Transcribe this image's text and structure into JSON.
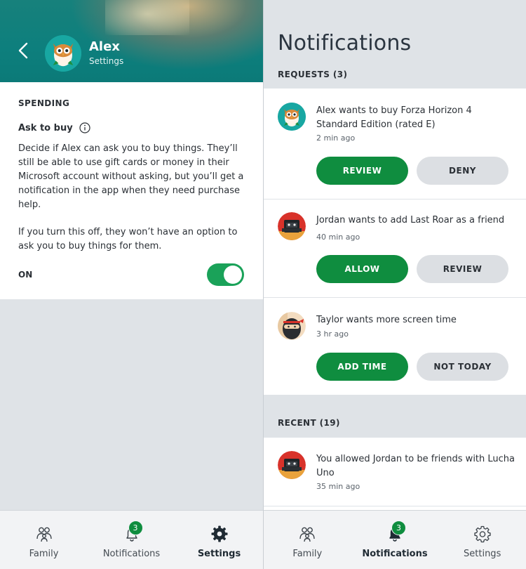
{
  "left": {
    "header": {
      "name": "Alex",
      "subtitle": "Settings"
    },
    "spending": {
      "section_label": "SPENDING",
      "ask_label": "Ask to buy",
      "description_1": "Decide if Alex can ask you to buy things. They’ll still be able to use gift cards or money in their Microsoft account without asking, but you’ll get a notification in the app when they need purchase help.",
      "description_2": "If you turn this off, they won’t have an option to ask you to buy things for them.",
      "toggle_label": "ON",
      "toggle_on": true
    },
    "nav": {
      "family": "Family",
      "notifications": "Notifications",
      "settings": "Settings",
      "badge": "3",
      "active": "settings"
    }
  },
  "right": {
    "title": "Notifications",
    "requests_label": "REQUESTS (3)",
    "requests": [
      {
        "text": "Alex wants to buy Forza Horizon 4 Standard Edition (rated E)",
        "time": "2 min ago",
        "primary": "REVIEW",
        "secondary": "DENY"
      },
      {
        "text": "Jordan wants to add Last Roar as a friend",
        "time": "40 min ago",
        "primary": "ALLOW",
        "secondary": "REVIEW"
      },
      {
        "text": "Taylor wants more screen time",
        "time": "3 hr ago",
        "primary": "ADD TIME",
        "secondary": "NOT TODAY"
      }
    ],
    "recent_label": "RECENT (19)",
    "recent": [
      {
        "text": "You allowed Jordan to be friends with Lucha Uno",
        "time": "35 min ago"
      }
    ],
    "nav": {
      "family": "Family",
      "notifications": "Notifications",
      "settings": "Settings",
      "badge": "3",
      "active": "notifications"
    }
  },
  "colors": {
    "accent_green": "#0f8d3f",
    "header_teal": "#0d7f7d",
    "toggle_green": "#1aa259",
    "background": "#dfe3e7"
  },
  "icons": {
    "back": "chevron-left-icon",
    "info": "info-icon",
    "family": "family-icon",
    "notifications": "bell-icon",
    "settings": "gear-icon"
  }
}
